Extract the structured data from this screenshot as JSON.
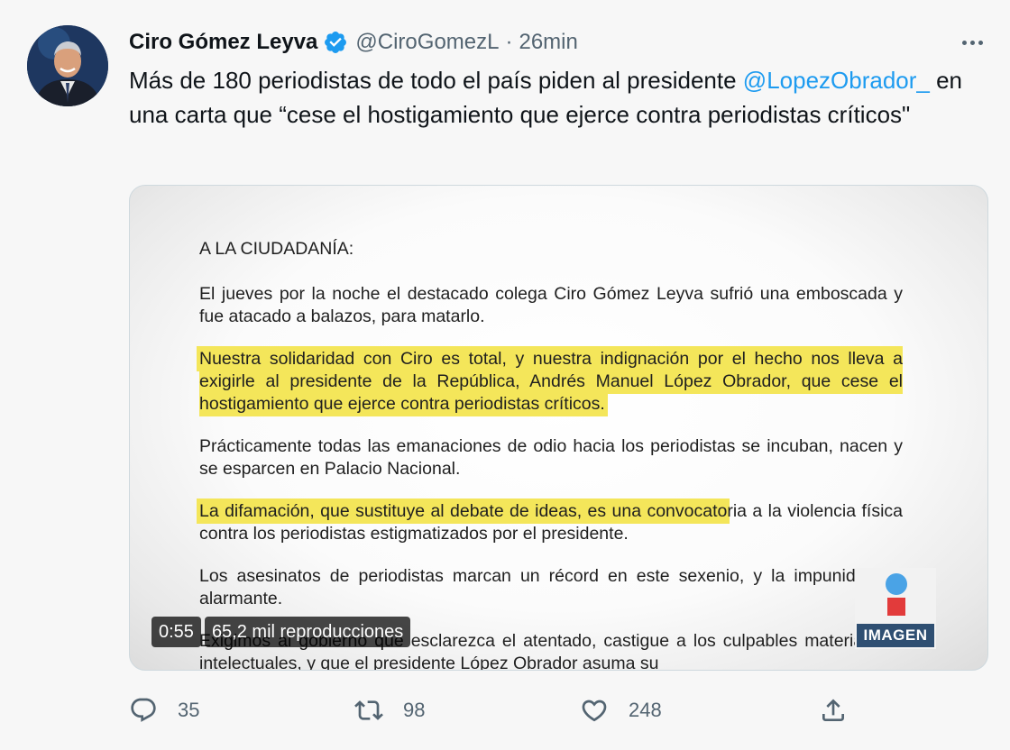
{
  "tweet": {
    "author_name": "Ciro Gómez Leyva",
    "handle": "@CiroGomezL",
    "separator": "·",
    "time": "26min",
    "text_before": "Más de 180 periodistas de todo el país piden al presidente ",
    "mention": "@LopezObrador_",
    "text_after": " en una carta que “cese el hostigamiento que ejerce contra periodistas críticos\""
  },
  "media": {
    "letter": {
      "heading": "A LA CIUDADANÍA:",
      "p1": "El jueves por la noche el destacado colega Ciro Gómez Leyva sufrió una emboscada y fue atacado a balazos, para matarlo.",
      "p2": "Nuestra solidaridad con Ciro es total, y nuestra indignación por el hecho nos lleva a exigirle al presidente de la República, Andrés Manuel López Obrador, que cese el hostigamiento que ejerce contra periodistas críticos.",
      "p3": "Prácticamente todas las emanaciones de odio hacia los periodistas se incuban, nacen y se esparcen en Palacio Nacional.",
      "p4_highlight": "La difamación, que sustituye al debate de ideas, es una convocato",
      "p4_rest": "ria a la violencia física contra los periodistas estigmatizados por el presidente.",
      "p5": "Los asesinatos de periodistas marcan un récord en este sexenio, y la impunidad es alarmante.",
      "p6": "Exigimos al gobierno que esclarezca el atentado, castigue a los culpables materiales e intelectuales, y que el presidente López Obrador asuma su"
    },
    "logo_text": "IMAGEN",
    "video_time": "0:55",
    "video_views": "65,2 mil reproducciones"
  },
  "actions": {
    "replies": "35",
    "retweets": "98",
    "likes": "248"
  },
  "colors": {
    "accent": "#1d9bf0",
    "secondary_text": "#536471",
    "highlight": "#f4e65a"
  },
  "icons": [
    "verified-badge-icon",
    "more-icon",
    "reply-icon",
    "retweet-icon",
    "like-icon",
    "share-icon"
  ]
}
